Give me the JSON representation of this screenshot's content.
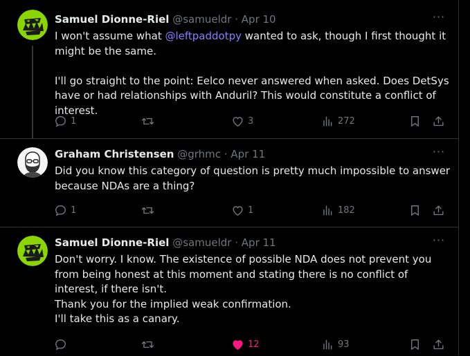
{
  "tweets": [
    {
      "author": "Samuel Dionne-Riel",
      "handle": "@samueldr",
      "separator": "·",
      "date": "Apr 10",
      "more": "···",
      "text_pre": "I won't assume what ",
      "mention": "@leftpaddotpy",
      "text_post": " wanted to ask, though I first thought it might be the same.",
      "paragraph2": "I'll go straight to the point: Eelco never answered when asked. Does DetSys have or had relationships with Anduril? This would constitute a conflict of interest.",
      "replies": "1",
      "reposts": "",
      "likes": "3",
      "views": "272",
      "liked": false
    },
    {
      "author": "Graham Christensen",
      "handle": "@grhmc",
      "separator": "·",
      "date": "Apr 11",
      "more": "···",
      "text": "Did you know this category of question is pretty much impossible to answer because NDAs are a thing?",
      "replies": "1",
      "reposts": "",
      "likes": "1",
      "views": "182",
      "liked": false
    },
    {
      "author": "Samuel Dionne-Riel",
      "handle": "@samueldr",
      "separator": "·",
      "date": "Apr 11",
      "more": "···",
      "line1": "Don't worry. I know. The existence of possible NDA does not prevent you from being honest at this moment and stating there is no conflict of interest, if there isn't.",
      "line2": "Thank you for the implied weak confirmation.",
      "line3": "I'll take this as a canary.",
      "replies": "",
      "reposts": "",
      "likes": "12",
      "views": "93",
      "liked": true
    }
  ],
  "colors": {
    "background": "#000000",
    "text": "#e7e9ea",
    "muted": "#71767b",
    "mention": "#8a7dff",
    "like_active": "#f91880",
    "avatar_green": "#8bd600"
  },
  "icons": {
    "reply": "reply-icon",
    "repost": "repost-icon",
    "like": "like-icon",
    "views": "views-icon",
    "bookmark": "bookmark-icon",
    "share": "share-icon",
    "more": "more-icon"
  }
}
